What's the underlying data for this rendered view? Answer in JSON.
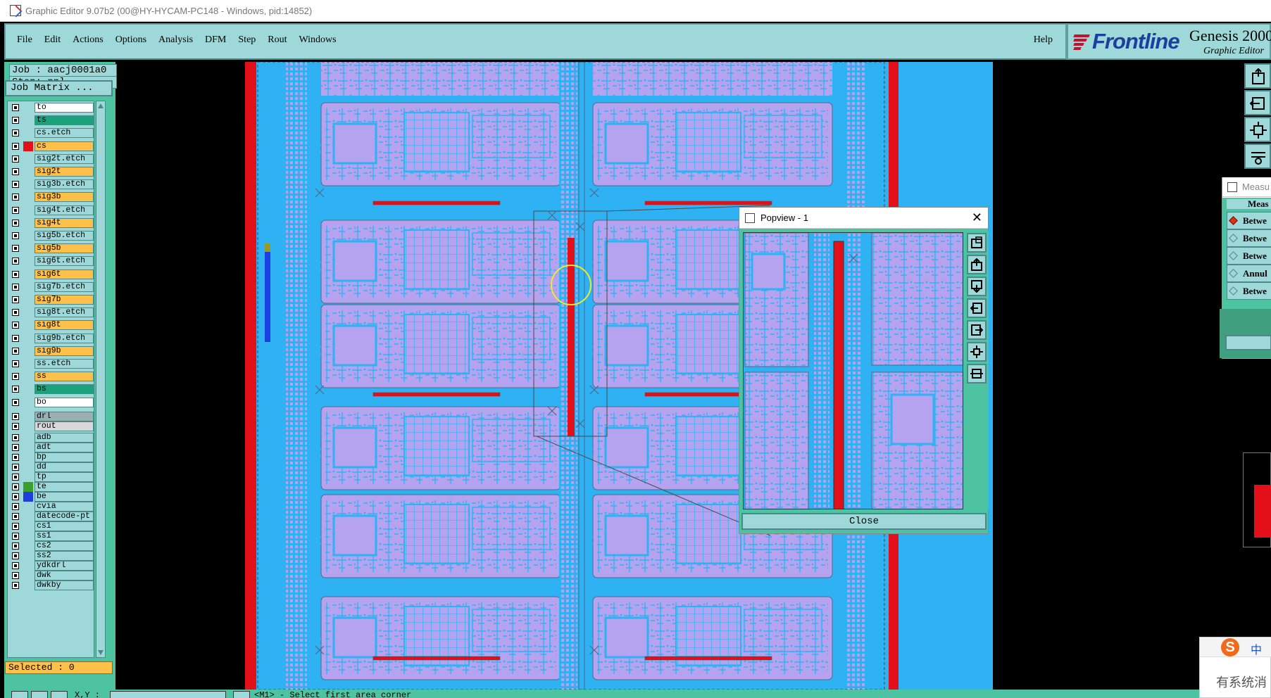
{
  "window": {
    "title": "Graphic Editor 9.07b2 (00@HY-HYCAM-PC148 - Windows, pid:14852)"
  },
  "menubar": {
    "items": [
      "File",
      "Edit",
      "Actions",
      "Options",
      "Analysis",
      "DFM",
      "Step",
      "Rout",
      "Windows"
    ],
    "help": "Help"
  },
  "logo": {
    "brand": "Frontline",
    "product": "Genesis 2000",
    "subtitle": "Graphic Editor"
  },
  "job": {
    "job_label": "Job : aacj0001a0",
    "step_label": "Step: pnl",
    "matrix_button": "Job Matrix ..."
  },
  "layers": [
    {
      "name": "to",
      "color": "#ffffff",
      "swatch": ""
    },
    {
      "name": "ts",
      "color": "#1aa37a",
      "swatch": ""
    },
    {
      "name": "cs.etch",
      "color": "#9ed8d8",
      "swatch": ""
    },
    {
      "name": "cs",
      "color": "#ffc04a",
      "swatch": "#e3101a"
    },
    {
      "name": "sig2t.etch",
      "color": "#9ed8d8",
      "swatch": ""
    },
    {
      "name": "sig2t",
      "color": "#ffc04a",
      "swatch": ""
    },
    {
      "name": "sig3b.etch",
      "color": "#9ed8d8",
      "swatch": ""
    },
    {
      "name": "sig3b",
      "color": "#ffc04a",
      "swatch": ""
    },
    {
      "name": "sig4t.etch",
      "color": "#9ed8d8",
      "swatch": ""
    },
    {
      "name": "sig4t",
      "color": "#ffc04a",
      "swatch": ""
    },
    {
      "name": "sig5b.etch",
      "color": "#9ed8d8",
      "swatch": ""
    },
    {
      "name": "sig5b",
      "color": "#ffc04a",
      "swatch": ""
    },
    {
      "name": "sig6t.etch",
      "color": "#9ed8d8",
      "swatch": ""
    },
    {
      "name": "sig6t",
      "color": "#ffc04a",
      "swatch": ""
    },
    {
      "name": "sig7b.etch",
      "color": "#9ed8d8",
      "swatch": ""
    },
    {
      "name": "sig7b",
      "color": "#ffc04a",
      "swatch": ""
    },
    {
      "name": "sig8t.etch",
      "color": "#9ed8d8",
      "swatch": ""
    },
    {
      "name": "sig8t",
      "color": "#ffc04a",
      "swatch": ""
    },
    {
      "name": "sig9b.etch",
      "color": "#9ed8d8",
      "swatch": ""
    },
    {
      "name": "sig9b",
      "color": "#ffc04a",
      "swatch": ""
    },
    {
      "name": "ss.etch",
      "color": "#9ed8d8",
      "swatch": ""
    },
    {
      "name": "ss",
      "color": "#ffc04a",
      "swatch": ""
    },
    {
      "name": "bs",
      "color": "#1aa37a",
      "swatch": ""
    },
    {
      "name": "bo",
      "color": "#ffffff",
      "swatch": ""
    },
    {
      "name": "drl",
      "color": "#9ab0b0",
      "swatch": ""
    },
    {
      "name": "rout",
      "color": "#d8d8d8",
      "swatch": ""
    },
    {
      "name": "adb",
      "color": "#9ed8d8",
      "swatch": ""
    },
    {
      "name": "adt",
      "color": "#9ed8d8",
      "swatch": ""
    },
    {
      "name": "bp",
      "color": "#9ed8d8",
      "swatch": ""
    },
    {
      "name": "dd",
      "color": "#9ed8d8",
      "swatch": ""
    },
    {
      "name": "tp",
      "color": "#9ed8d8",
      "swatch": ""
    },
    {
      "name": "te",
      "color": "#9ed8d8",
      "swatch": "#3aa02a"
    },
    {
      "name": "be",
      "color": "#9ed8d8",
      "swatch": "#1d3fe0"
    },
    {
      "name": "cvia",
      "color": "#9ed8d8",
      "swatch": ""
    },
    {
      "name": "datecode-pt",
      "color": "#9ed8d8",
      "swatch": ""
    },
    {
      "name": "cs1",
      "color": "#9ed8d8",
      "swatch": ""
    },
    {
      "name": "ss1",
      "color": "#9ed8d8",
      "swatch": ""
    },
    {
      "name": "cs2",
      "color": "#9ed8d8",
      "swatch": ""
    },
    {
      "name": "ss2",
      "color": "#9ed8d8",
      "swatch": ""
    },
    {
      "name": "ydkdrl",
      "color": "#9ed8d8",
      "swatch": ""
    },
    {
      "name": "dwk",
      "color": "#9ed8d8",
      "swatch": ""
    },
    {
      "name": "dwkby",
      "color": "#9ed8d8",
      "swatch": ""
    }
  ],
  "selected": "Selected : 0",
  "popview": {
    "title": "Popview - 1",
    "close_button": "Close"
  },
  "measure": {
    "title": "Measu",
    "header": "Meas",
    "options": [
      "Betwe",
      "Betwe",
      "Betwe",
      "Annul",
      "Betwe"
    ],
    "active_index": 0
  },
  "status": {
    "xy_label": "X,Y :",
    "prompt": "<M1> - Select first area corner"
  },
  "ime": {
    "zh": "中",
    "text": "有系统消"
  },
  "colors": {
    "board_copper": "#2fb2f3",
    "board_fill": "#b6a3ef",
    "highlight_red": "#e3101a",
    "panel_bg": "#4ec3a1",
    "button_bg": "#9ed8d8",
    "active_layer": "#ffc04a"
  },
  "icons": [
    "app-icon",
    "close-icon",
    "zoom-icon",
    "pan-icon",
    "fit-icon",
    "measure-icon",
    "ime-logo-icon"
  ]
}
